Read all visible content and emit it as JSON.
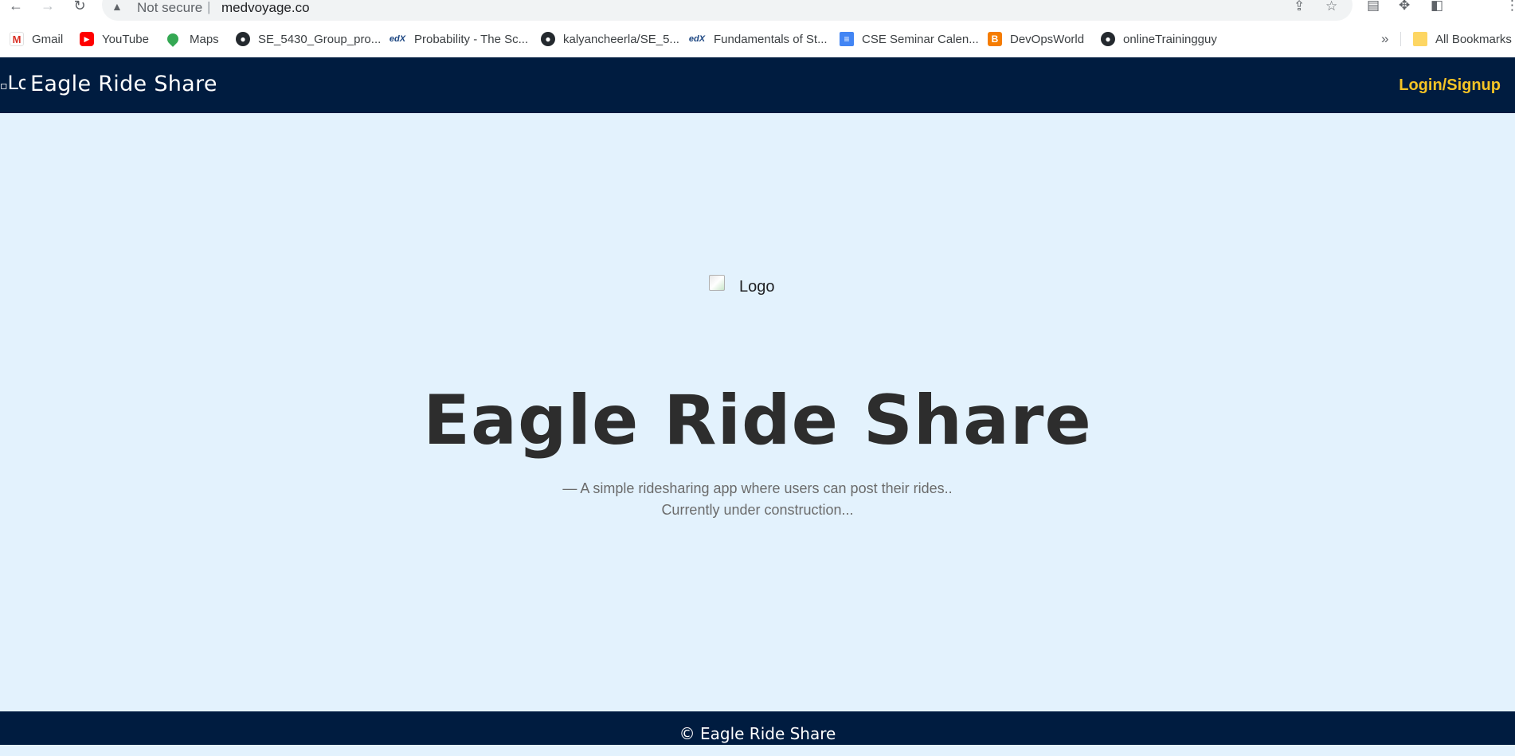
{
  "browser": {
    "security_label": "Not secure",
    "url": "medvoyage.co",
    "bookmarks": [
      {
        "label": "Gmail",
        "icon": "gmail-icon"
      },
      {
        "label": "YouTube",
        "icon": "youtube-icon"
      },
      {
        "label": "Maps",
        "icon": "maps-icon"
      },
      {
        "label": "SE_5430_Group_pro...",
        "icon": "github-icon"
      },
      {
        "label": "Probability - The Sc...",
        "icon": "fx-icon"
      },
      {
        "label": "kalyancheerla/SE_5...",
        "icon": "github-icon"
      },
      {
        "label": "Fundamentals of St...",
        "icon": "fx-icon"
      },
      {
        "label": "CSE Seminar Calen...",
        "icon": "docs-icon"
      },
      {
        "label": "DevOpsWorld",
        "icon": "blogger-icon"
      },
      {
        "label": "onlineTrainingguy",
        "icon": "github-icon"
      }
    ],
    "all_bookmarks_label": "All Bookmarks",
    "more_label": "»"
  },
  "header": {
    "logo_alt": "Lo",
    "title": "Eagle Ride Share",
    "login_label": "Login/Signup"
  },
  "hero": {
    "logo_alt": "Logo",
    "title": "Eagle Ride Share",
    "subtitle_line1": "— A simple ridesharing app where users can post their rides..",
    "subtitle_line2": "Currently under construction..."
  },
  "footer": {
    "text": "© Eagle Ride Share"
  },
  "colors": {
    "header_bg": "#001c40",
    "page_bg": "#e3f2fd",
    "accent": "#f6c425"
  }
}
